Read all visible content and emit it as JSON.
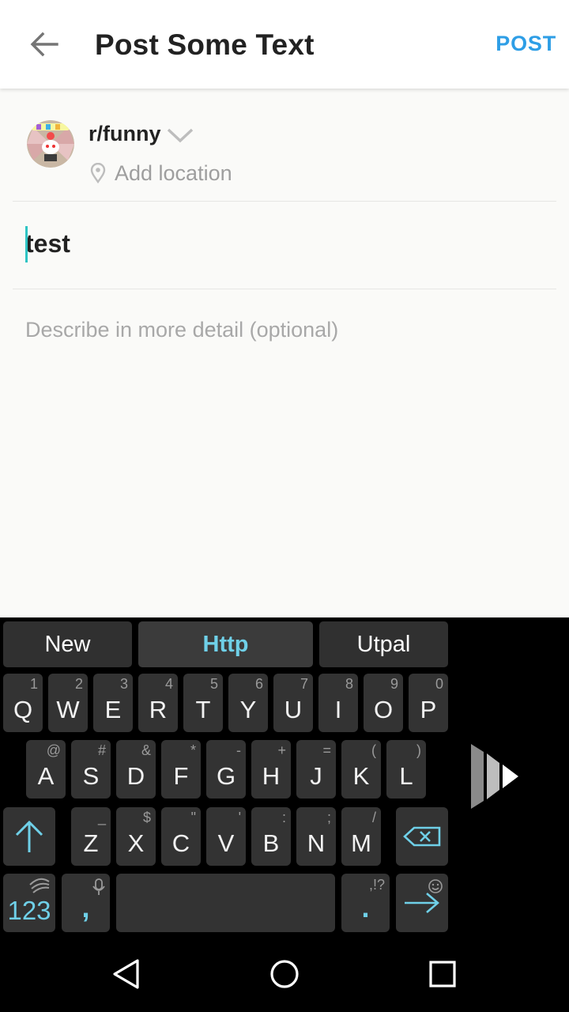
{
  "appbar": {
    "title": "Post Some Text",
    "post_label": "POST",
    "back_icon": "arrow-left-icon"
  },
  "post": {
    "subreddit": "r/funny",
    "location_placeholder": "Add location",
    "title_value": "test",
    "body_placeholder": "Describe in more detail (optional)"
  },
  "keyboard": {
    "suggestions": [
      "New",
      "Http",
      "Utpal"
    ],
    "rows": [
      [
        {
          "k": "Q",
          "s": "1"
        },
        {
          "k": "W",
          "s": "2"
        },
        {
          "k": "E",
          "s": "3"
        },
        {
          "k": "R",
          "s": "4"
        },
        {
          "k": "T",
          "s": "5"
        },
        {
          "k": "Y",
          "s": "6"
        },
        {
          "k": "U",
          "s": "7"
        },
        {
          "k": "I",
          "s": "8"
        },
        {
          "k": "O",
          "s": "9"
        },
        {
          "k": "P",
          "s": "0"
        }
      ],
      [
        {
          "k": "A",
          "s": "@"
        },
        {
          "k": "S",
          "s": "#"
        },
        {
          "k": "D",
          "s": "&"
        },
        {
          "k": "F",
          "s": "*"
        },
        {
          "k": "G",
          "s": "-"
        },
        {
          "k": "H",
          "s": "+"
        },
        {
          "k": "J",
          "s": "="
        },
        {
          "k": "K",
          "s": "("
        },
        {
          "k": "L",
          "s": ")"
        }
      ],
      [
        {
          "k": "Z",
          "s": "_"
        },
        {
          "k": "X",
          "s": "$"
        },
        {
          "k": "C",
          "s": "\""
        },
        {
          "k": "V",
          "s": "'"
        },
        {
          "k": "B",
          "s": ":"
        },
        {
          "k": "N",
          "s": ";"
        },
        {
          "k": "M",
          "s": "/"
        }
      ]
    ],
    "numbers_label": "123",
    "comma_label": ",",
    "period_label": ".",
    "period_secondary": ",!?",
    "accent_color": "#6fd0e8"
  },
  "navbar": {
    "back_icon": "triangle-back-icon",
    "home_icon": "circle-home-icon",
    "recents_icon": "square-recents-icon"
  }
}
